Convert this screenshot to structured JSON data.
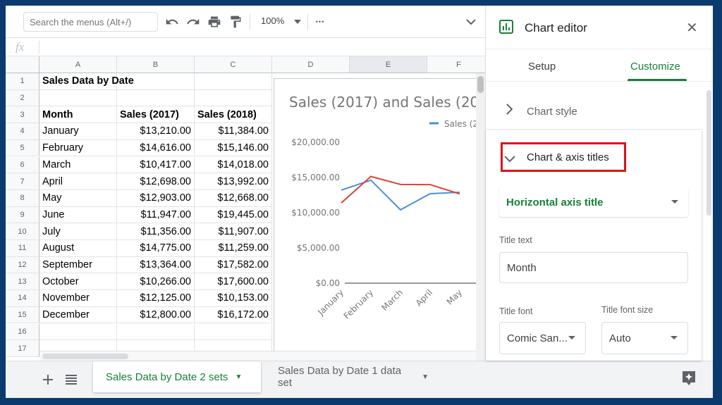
{
  "toolbar": {
    "search_placeholder": "Search the menus (Alt+/)",
    "zoom": "100%",
    "more": "•••",
    "collapse": "⌃",
    "icons": [
      "undo-icon",
      "redo-icon",
      "print-icon",
      "paint-format-icon",
      "chevron-down-icon",
      "more-horiz-icon",
      "collapse-icon"
    ]
  },
  "formula_bar": {
    "fx": "fx",
    "value": ""
  },
  "grid": {
    "columns": [
      "A",
      "B",
      "C",
      "D",
      "E",
      "F"
    ],
    "selected_column": "E",
    "rows": [
      [
        "Sales Data by Date",
        "",
        ""
      ],
      [
        "",
        "",
        ""
      ],
      [
        "Month",
        "Sales (2017)",
        "Sales (2018)"
      ],
      [
        "January",
        "$13,210.00",
        "$11,384.00"
      ],
      [
        "February",
        "$14,616.00",
        "$15,146.00"
      ],
      [
        "March",
        "$10,417.00",
        "$14,018.00"
      ],
      [
        "April",
        "$12,698.00",
        "$13,992.00"
      ],
      [
        "May",
        "$12,903.00",
        "$12,668.00"
      ],
      [
        "June",
        "$11,947.00",
        "$19,445.00"
      ],
      [
        "July",
        "$11,356.00",
        "$11,907.00"
      ],
      [
        "August",
        "$14,775.00",
        "$11,259.00"
      ],
      [
        "September",
        "$13,364.00",
        "$17,582.00"
      ],
      [
        "October",
        "$10,266.00",
        "$17,600.00"
      ],
      [
        "November",
        "$12,125.00",
        "$10,153.00"
      ],
      [
        "December",
        "$12,800.00",
        "$16,172.00"
      ],
      [
        "",
        "",
        ""
      ],
      [
        "",
        "",
        ""
      ]
    ]
  },
  "chart_data": {
    "type": "line",
    "title": "Sales (2017) and Sales (20",
    "legend_label": "Sales (2",
    "legend_position": "top-right",
    "categories": [
      "January",
      "February",
      "March",
      "April",
      "May"
    ],
    "series": [
      {
        "name": "Sales (2017)",
        "color": "#4a90d9",
        "values": [
          13210,
          14616,
          10417,
          12698,
          12903
        ]
      },
      {
        "name": "Sales (2018)",
        "color": "#db4437",
        "values": [
          11384,
          15146,
          14018,
          13992,
          12668
        ]
      }
    ],
    "yticks": [
      "$20,000.00",
      "$15,000.00",
      "$10,000.00",
      "$5,000.00",
      "$0.00"
    ],
    "ylim": [
      0,
      20000
    ],
    "grid": false
  },
  "sheet_tabs": {
    "tabs": [
      {
        "label": "Sales Data by Date 2 sets",
        "active": true
      },
      {
        "label": "Sales Data by Date 1 data set",
        "active": false
      }
    ]
  },
  "editor": {
    "title": "Chart editor",
    "close": "✕",
    "tabs": [
      "Setup",
      "Customize"
    ],
    "active_tab": "Customize",
    "sections": {
      "chart_style": "Chart style",
      "chart_axis_titles": "Chart & axis titles"
    },
    "axis_dropdown": "Horizontal axis title",
    "title_text_label": "Title text",
    "title_text_value": "Month",
    "title_font_label": "Title font",
    "title_font_value": "Comic San...",
    "title_font_size_label": "Title font size",
    "title_font_size_value": "Auto",
    "accent": "#188038",
    "highlight": "#e0121b"
  }
}
